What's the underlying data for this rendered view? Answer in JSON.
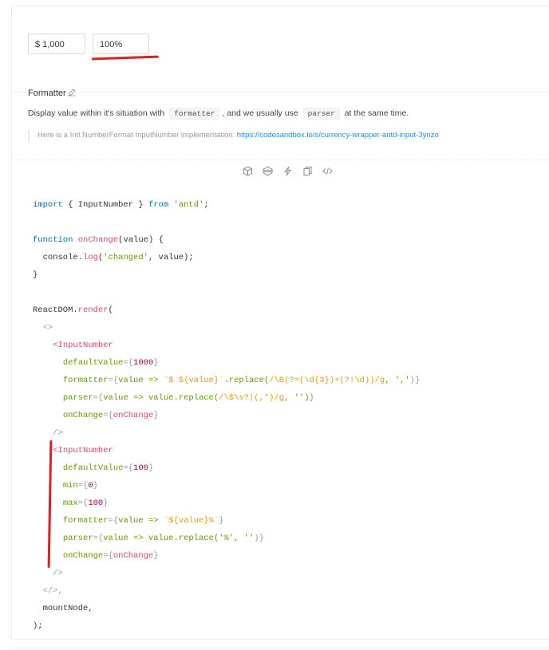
{
  "demo": {
    "input1_value": "$ 1,000",
    "input2_value": "100%"
  },
  "section": {
    "title": "Formatter",
    "desc_before": "Display value within it's situation with",
    "code1": "formatter",
    "desc_middle": ", and we usually use",
    "code2": "parser",
    "desc_after": "at the same time.",
    "quote_text": "Here is a Intl.NumberFormat InputNumber implementation:",
    "quote_link": "https://codesandbox.io/s/currency-wrapper-antd-input-3ynzo"
  },
  "actions": [
    "codesandbox-icon",
    "codepen-icon",
    "thunder-icon",
    "copy-icon",
    "code-expand-icon"
  ],
  "colors": {
    "accent": "#1890ff",
    "red_marker": "#e02020"
  },
  "code": [
    [
      {
        "t": "import",
        "c": "kw"
      },
      {
        "t": " { InputNumber } ",
        "c": ""
      },
      {
        "t": "from",
        "c": "kw"
      },
      {
        "t": " ",
        "c": ""
      },
      {
        "t": "'antd'",
        "c": "str"
      },
      {
        "t": ";",
        "c": ""
      }
    ],
    [],
    [
      {
        "t": "function",
        "c": "kw"
      },
      {
        "t": " ",
        "c": ""
      },
      {
        "t": "onChange",
        "c": "fn"
      },
      {
        "t": "(value) {",
        "c": ""
      }
    ],
    [
      {
        "t": "  console.",
        "c": ""
      },
      {
        "t": "log",
        "c": "fn"
      },
      {
        "t": "(",
        "c": ""
      },
      {
        "t": "'changed'",
        "c": "str"
      },
      {
        "t": ", value);",
        "c": ""
      }
    ],
    [
      {
        "t": "}",
        "c": ""
      }
    ],
    [],
    [
      {
        "t": "ReactDOM.",
        "c": ""
      },
      {
        "t": "render",
        "c": "fn"
      },
      {
        "t": "(",
        "c": ""
      }
    ],
    [
      {
        "t": "  <>",
        "c": "punc"
      }
    ],
    [
      {
        "t": "    ",
        "c": ""
      },
      {
        "t": "<InputNumber",
        "c": "fn"
      }
    ],
    [
      {
        "t": "      ",
        "c": ""
      },
      {
        "t": "defaultValue",
        "c": "attr"
      },
      {
        "t": "={",
        "c": "punc"
      },
      {
        "t": "1000",
        "c": "num"
      },
      {
        "t": "}",
        "c": "punc"
      }
    ],
    [
      {
        "t": "      ",
        "c": ""
      },
      {
        "t": "formatter",
        "c": "attr"
      },
      {
        "t": "={",
        "c": "punc"
      },
      {
        "t": "value => ",
        "c": "str"
      },
      {
        "t": "`$ ${value}`",
        "c": "rx"
      },
      {
        "t": ".replace(",
        "c": "str"
      },
      {
        "t": "/\\B(?=(\\d{3})+(?!\\d))/g",
        "c": "rx"
      },
      {
        "t": ", ','",
        "c": "str"
      },
      {
        "t": ")}",
        "c": "punc"
      }
    ],
    [
      {
        "t": "      ",
        "c": ""
      },
      {
        "t": "parser",
        "c": "attr"
      },
      {
        "t": "={",
        "c": "punc"
      },
      {
        "t": "value => value.replace(",
        "c": "str"
      },
      {
        "t": "/\\$\\s?|(,*)/g",
        "c": "rx"
      },
      {
        "t": ", '')",
        "c": "str"
      },
      {
        "t": "}",
        "c": "punc"
      }
    ],
    [
      {
        "t": "      ",
        "c": ""
      },
      {
        "t": "onChange",
        "c": "attr"
      },
      {
        "t": "={",
        "c": "punc"
      },
      {
        "t": "onChange",
        "c": "fn"
      },
      {
        "t": "}",
        "c": "punc"
      }
    ],
    [
      {
        "t": "    />",
        "c": "punc"
      }
    ],
    [
      {
        "t": "    ",
        "c": ""
      },
      {
        "t": "<InputNumber",
        "c": "fn"
      }
    ],
    [
      {
        "t": "      ",
        "c": ""
      },
      {
        "t": "defaultValue",
        "c": "attr"
      },
      {
        "t": "={",
        "c": "punc"
      },
      {
        "t": "100",
        "c": "num"
      },
      {
        "t": "}",
        "c": "punc"
      }
    ],
    [
      {
        "t": "      ",
        "c": ""
      },
      {
        "t": "min",
        "c": "attr"
      },
      {
        "t": "={",
        "c": "punc"
      },
      {
        "t": "0",
        "c": "num"
      },
      {
        "t": "}",
        "c": "punc"
      }
    ],
    [
      {
        "t": "      ",
        "c": ""
      },
      {
        "t": "max",
        "c": "attr"
      },
      {
        "t": "={",
        "c": "punc"
      },
      {
        "t": "100",
        "c": "num"
      },
      {
        "t": "}",
        "c": "punc"
      }
    ],
    [
      {
        "t": "      ",
        "c": ""
      },
      {
        "t": "formatter",
        "c": "attr"
      },
      {
        "t": "={",
        "c": "punc"
      },
      {
        "t": "value => ",
        "c": "str"
      },
      {
        "t": "`${value}%`",
        "c": "rx"
      },
      {
        "t": "}",
        "c": "punc"
      }
    ],
    [
      {
        "t": "      ",
        "c": ""
      },
      {
        "t": "parser",
        "c": "attr"
      },
      {
        "t": "={",
        "c": "punc"
      },
      {
        "t": "value => value.replace(",
        "c": "str"
      },
      {
        "t": "'%', ''",
        "c": "str"
      },
      {
        "t": ")}",
        "c": "punc"
      }
    ],
    [
      {
        "t": "      ",
        "c": ""
      },
      {
        "t": "onChange",
        "c": "attr"
      },
      {
        "t": "={",
        "c": "punc"
      },
      {
        "t": "onChange",
        "c": "fn"
      },
      {
        "t": "}",
        "c": "punc"
      }
    ],
    [
      {
        "t": "    />",
        "c": "punc"
      }
    ],
    [
      {
        "t": "  </>,",
        "c": "punc"
      }
    ],
    [
      {
        "t": "  mountNode,",
        "c": ""
      }
    ],
    [
      {
        "t": ");",
        "c": ""
      }
    ]
  ]
}
